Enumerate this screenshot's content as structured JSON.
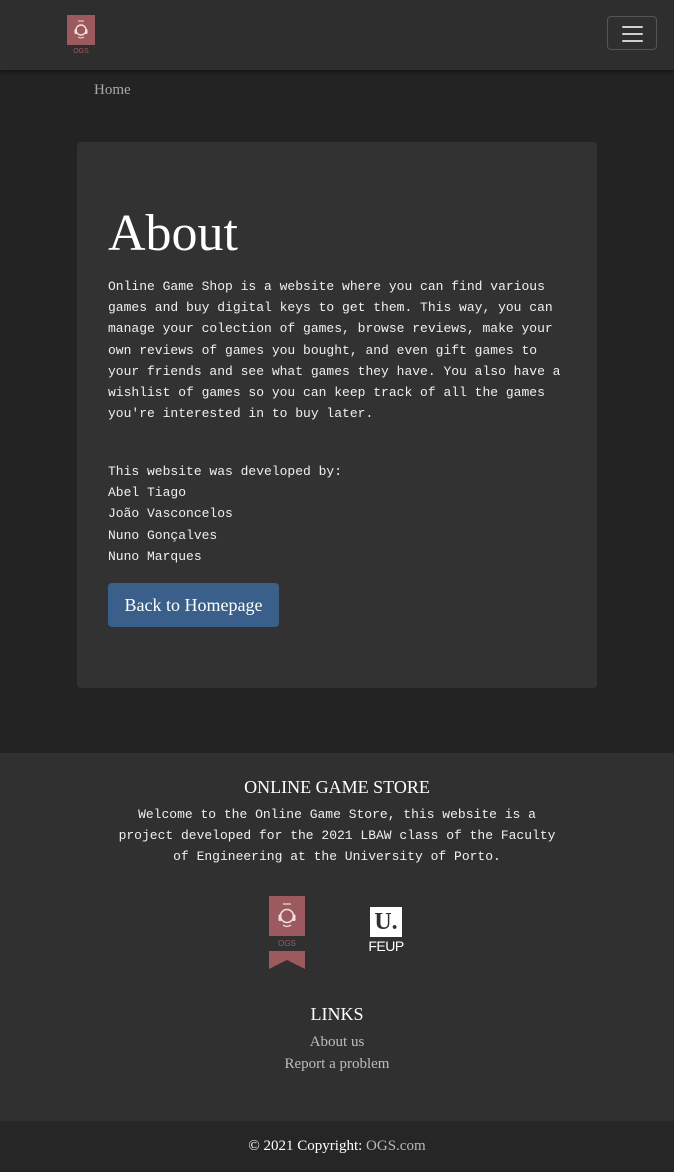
{
  "colors": {
    "brand": "#9c5a5e",
    "button": "#3a5f8a",
    "background": "#232323",
    "card": "#323232",
    "footer": "#303030"
  },
  "navbar": {
    "logo_text": "OGS",
    "toggle_icon": "hamburger-menu-icon"
  },
  "breadcrumb": {
    "home": "Home"
  },
  "about": {
    "title": "About",
    "description": "Online Game Shop is a website where you can find various games and buy digital keys to get them. This way, you can manage your colection of games, browse reviews, make your own reviews of games you bought, and even gift games to your friends and see what games they have. You also have a wishlist of games so you can keep track of all the games you're interested in to buy later.",
    "developed_by": "This website was developed by:",
    "developers": [
      "Abel Tiago",
      "João Vasconcelos",
      "Nuno Gonçalves",
      "Nuno Marques"
    ],
    "back_button": "Back to Homepage"
  },
  "footer": {
    "title": "ONLINE GAME STORE",
    "description": "Welcome to the Online Game Store, this website is a project developed for the 2021 LBAW class of the Faculty of Engineering at the University of Porto.",
    "ogs_logo_text": "OGS",
    "feup_mark": "U.",
    "feup_label": "FEUP",
    "links_title": "LINKS",
    "links": [
      "About us",
      "Report a problem"
    ]
  },
  "copyright": {
    "prefix": "© 2021 Copyright:",
    "site": "OGS.com"
  }
}
